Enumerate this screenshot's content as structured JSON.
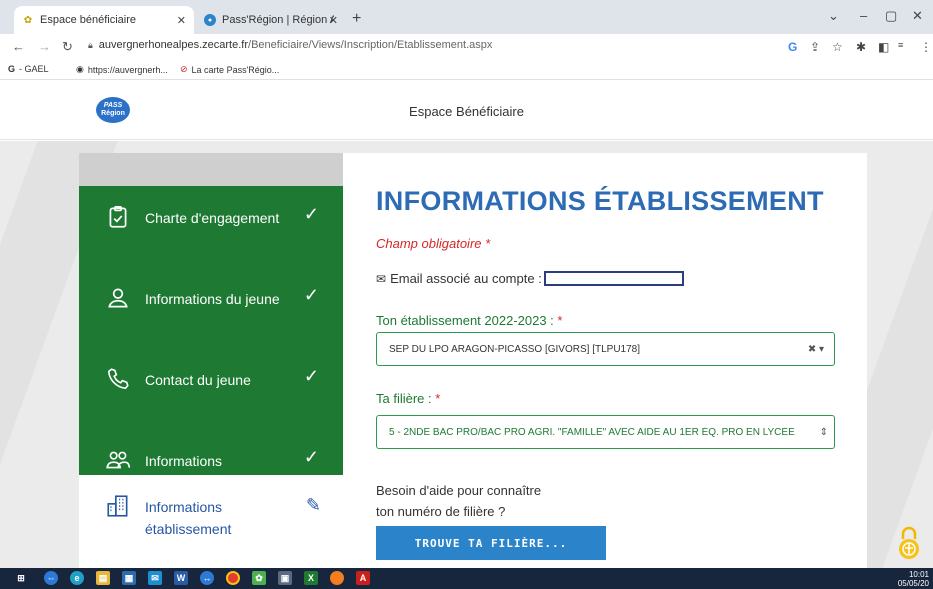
{
  "browser": {
    "tabs": [
      {
        "title": "Espace bénéficiaire",
        "active": true
      },
      {
        "title": "Pass'Région | Région Auvergne-R",
        "active": false
      }
    ],
    "url_host": "auvergnerhonealpes.zecarte.fr",
    "url_path": "/Beneficiaire/Views/Inscription/Etablissement.aspx",
    "bookmarks": [
      "- GAEL",
      "https://auvergnerh...",
      "La carte Pass'Régio..."
    ]
  },
  "site": {
    "logo_line1": "PASS",
    "logo_line2": "Région",
    "header_title": "Espace Bénéficiaire"
  },
  "steps": [
    {
      "label": "Charte d'engagement",
      "status": "done"
    },
    {
      "label": "Informations du jeune",
      "status": "done"
    },
    {
      "label": "Contact du jeune",
      "status": "done"
    },
    {
      "label": "Informations responsable",
      "status": "done"
    },
    {
      "label": "Informations établissement",
      "status": "current"
    }
  ],
  "form": {
    "title": "INFORMATIONS ÉTABLISSEMENT",
    "required_note": "Champ obligatoire *",
    "email_label": "Email associé au compte :",
    "establishment_label": "Ton établissement 2022-2023 :",
    "establishment_value": "SEP DU LPO ARAGON-PICASSO [GIVORS] [TLPU178]",
    "filiere_label": "Ta filière :",
    "filiere_value": "5 - 2NDE BAC PRO/BAC PRO AGRI. \"FAMILLE\" AVEC AIDE AU 1ER ÉQ. PRO EN LYCÉE",
    "required_star": "*",
    "help_line1": "Besoin d'aide pour connaître",
    "help_line2": "ton numéro de filière ?",
    "find_button": "TROUVE TA FILIÈRE..."
  },
  "taskbar": {
    "time": "10:01",
    "date": "05/05/20"
  },
  "colors": {
    "step_done": "#1e7a33",
    "title_blue": "#2d6bb5",
    "button_blue": "#2b83c9",
    "required_red": "#d62727"
  }
}
